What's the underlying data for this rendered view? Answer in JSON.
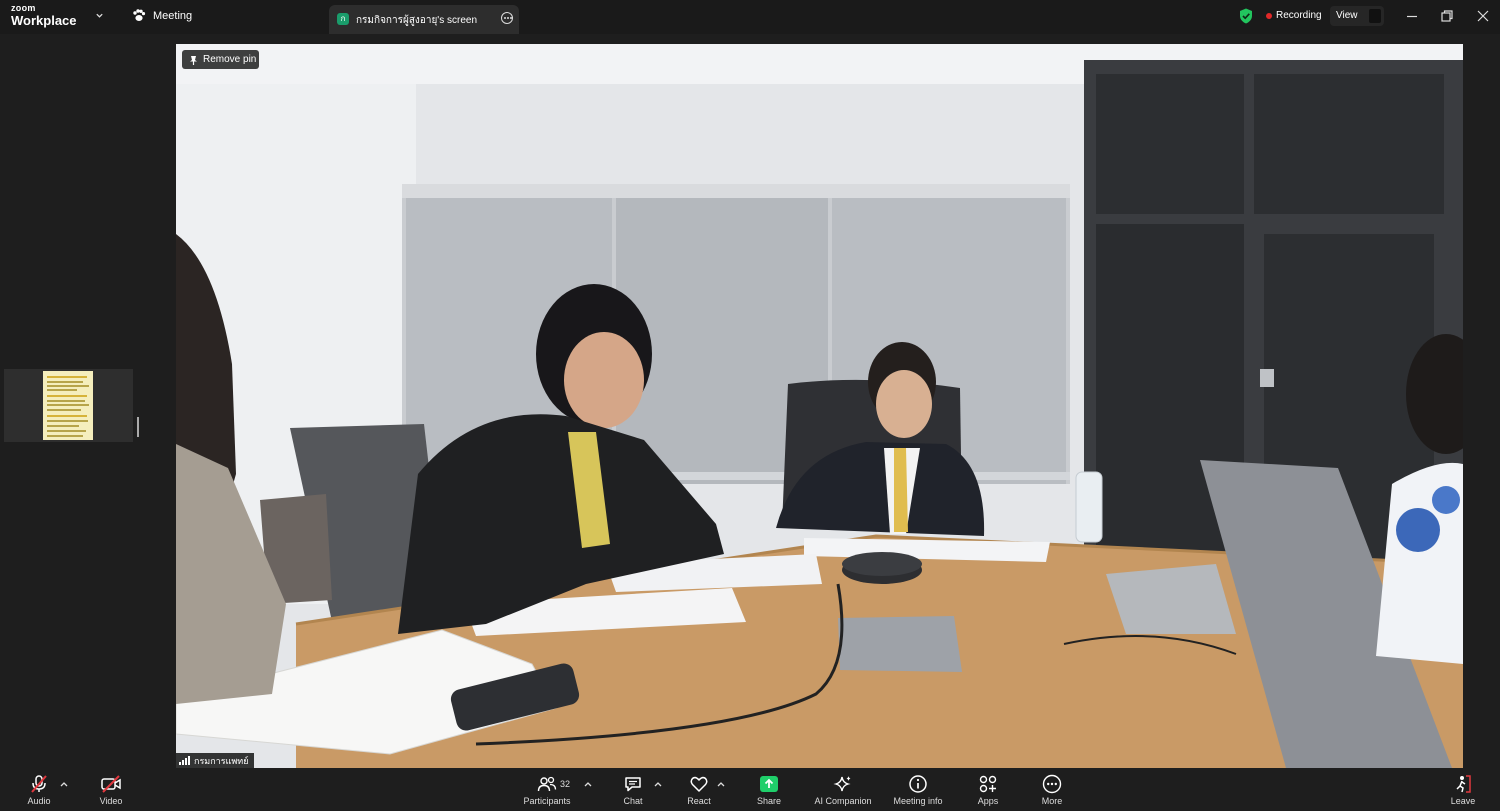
{
  "titlebar": {
    "brand_top": "zoom",
    "brand_main": "Workplace",
    "meeting_label": "Meeting",
    "tab_badge": "ก",
    "tab_label": "กรมกิจการผู้สูงอายุ's screen",
    "recording_label": "Recording",
    "view_label": "View"
  },
  "video": {
    "remove_pin_label": "Remove pin",
    "participant_name": "กรมการแพทย์"
  },
  "toolbar": {
    "audio_label": "Audio",
    "video_label": "Video",
    "participants_count": "32",
    "participants_label": "Participants",
    "chat_label": "Chat",
    "react_label": "React",
    "share_label": "Share",
    "ai_label": "AI Companion",
    "info_label": "Meeting info",
    "apps_label": "Apps",
    "more_label": "More",
    "leave_label": "Leave"
  },
  "colors": {
    "share_green": "#1fcf6a",
    "muted_red": "#e0383e",
    "recording_red": "#e02828",
    "shield_green": "#22c55e",
    "tab_badge": "#1a9c6b"
  },
  "icons": [
    "zoom-caret-icon",
    "paw-meeting-icon",
    "tab-more-icon",
    "encryption-shield-icon",
    "minimize-icon",
    "restore-icon",
    "close-icon",
    "pin-icon",
    "signal-icon",
    "mic-muted-icon",
    "video-off-icon",
    "participants-icon",
    "chat-icon",
    "heart-react-icon",
    "share-arrow-icon",
    "sparkle-ai-icon",
    "info-icon",
    "apps-icon",
    "more-dots-icon",
    "leave-icon"
  ]
}
